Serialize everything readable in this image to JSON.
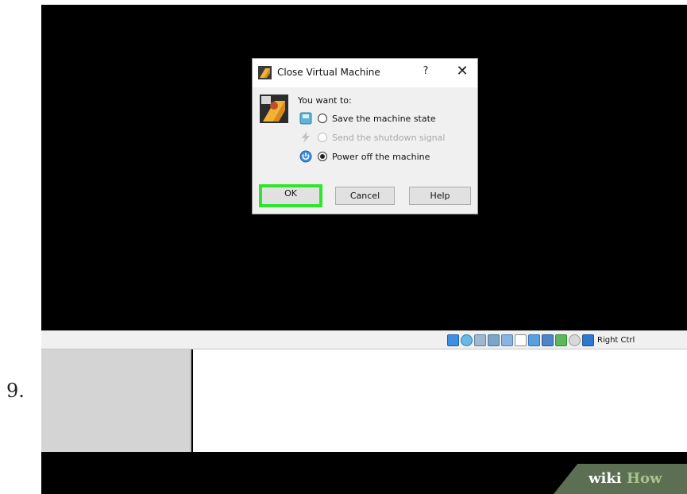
{
  "step": {
    "number": "9."
  },
  "dialog": {
    "title": "Close Virtual Machine",
    "help_glyph": "?",
    "close_glyph": "✕",
    "prompt": "You want to:",
    "options": [
      {
        "label": "Save the machine state",
        "icon": "save-state-icon",
        "checked": false,
        "disabled": false
      },
      {
        "label": "Send the shutdown signal",
        "icon": "acpi-shutdown-icon",
        "checked": false,
        "disabled": true
      },
      {
        "label": "Power off the machine",
        "icon": "power-off-icon",
        "checked": true,
        "disabled": false
      }
    ],
    "buttons": {
      "ok": "OK",
      "cancel": "Cancel",
      "help": "Help"
    },
    "highlight_color": "#2ee62e"
  },
  "status_bar": {
    "icons": [
      "hard-disk-icon",
      "optical-drive-icon",
      "audio-icon",
      "network-icon",
      "usb-icon",
      "shared-folders-icon",
      "display-icon",
      "video-capture-icon",
      "vrde-icon",
      "cpu-icon",
      "mouse-integration-icon"
    ],
    "host_key": "Right Ctrl"
  },
  "watermark": {
    "wiki": "wiki",
    "how": "How"
  }
}
